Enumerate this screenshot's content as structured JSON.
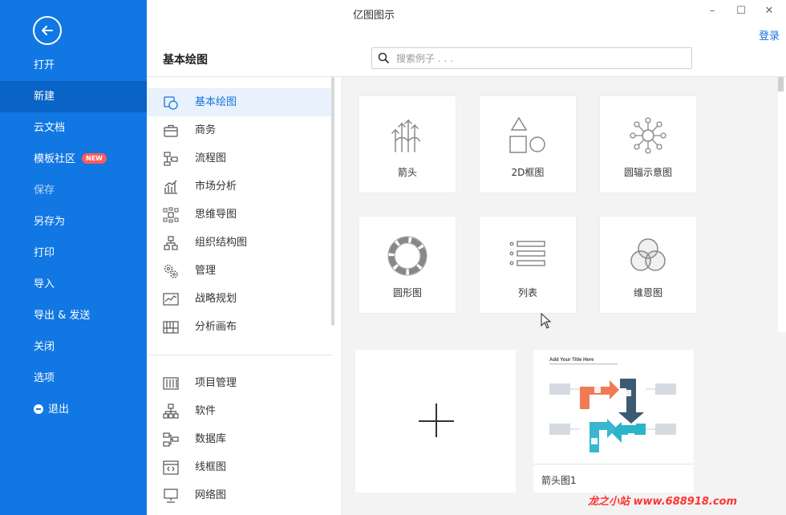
{
  "window": {
    "title": "亿图图示",
    "minimize": "–",
    "maximize": "☐",
    "close": "✕",
    "login": "登录"
  },
  "sidebar": {
    "items": [
      {
        "label": "打开"
      },
      {
        "label": "新建"
      },
      {
        "label": "云文档"
      },
      {
        "label": "模板社区",
        "badge": "NEW"
      },
      {
        "label": "保存"
      },
      {
        "label": "另存为"
      },
      {
        "label": "打印"
      },
      {
        "label": "导入"
      },
      {
        "label": "导出 & 发送"
      },
      {
        "label": "关闭"
      },
      {
        "label": "选项"
      },
      {
        "label": "退出"
      }
    ]
  },
  "category_header": "基本绘图",
  "search": {
    "placeholder": "搜索例子 . . ."
  },
  "categories": {
    "group1": [
      {
        "label": "基本绘图",
        "icon": "shapes-icon"
      },
      {
        "label": "商务",
        "icon": "briefcase-icon"
      },
      {
        "label": "流程图",
        "icon": "flowchart-icon"
      },
      {
        "label": "市场分析",
        "icon": "bar-chart-icon"
      },
      {
        "label": "思维导图",
        "icon": "mindmap-icon"
      },
      {
        "label": "组织结构图",
        "icon": "org-chart-icon"
      },
      {
        "label": "管理",
        "icon": "gears-icon"
      },
      {
        "label": "战略规划",
        "icon": "strategy-icon"
      },
      {
        "label": "分析画布",
        "icon": "canvas-icon"
      }
    ],
    "group2": [
      {
        "label": "项目管理",
        "icon": "gantt-icon"
      },
      {
        "label": "软件",
        "icon": "software-icon"
      },
      {
        "label": "数据库",
        "icon": "database-icon"
      },
      {
        "label": "线框图",
        "icon": "wireframe-icon"
      },
      {
        "label": "网络图",
        "icon": "network-icon"
      }
    ]
  },
  "templates": [
    {
      "label": "箭头",
      "icon": "arrows-icon"
    },
    {
      "label": "2D框图",
      "icon": "2d-shapes-icon"
    },
    {
      "label": "圆辐示意图",
      "icon": "radial-icon"
    },
    {
      "label": "圆形图",
      "icon": "circle-diagram-icon"
    },
    {
      "label": "列表",
      "icon": "list-icon"
    },
    {
      "label": "维恩图",
      "icon": "venn-icon"
    }
  ],
  "recent": {
    "template_name": "箭头图1",
    "thumb_title": "Add Your Title Here"
  },
  "watermark": "龙之小站 www.688918.com",
  "colors": {
    "sidebar": "#1177e3",
    "accent": "#1a73d9",
    "badge": "#ff5b5b",
    "thumb_orange": "#f07a55",
    "thumb_navy": "#3d5a73",
    "thumb_teal": "#2bb5c8",
    "thumb_cyan": "#39b6d1"
  }
}
